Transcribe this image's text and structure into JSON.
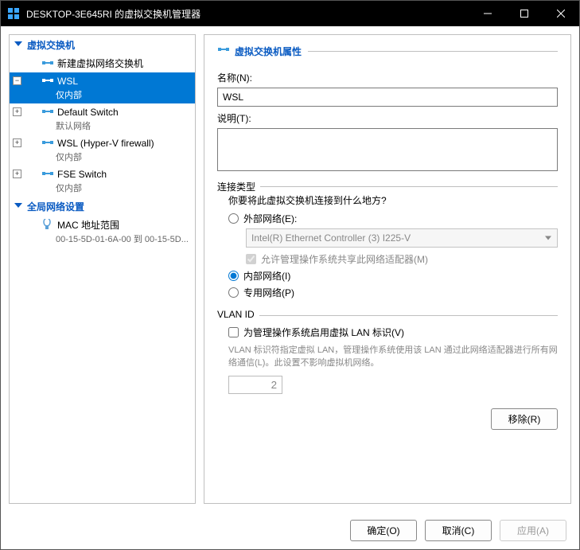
{
  "window": {
    "title": "DESKTOP-3E645RI 的虚拟交换机管理器"
  },
  "tree": {
    "section_switches": "虚拟交换机",
    "new_switch": "新建虚拟网络交换机",
    "items": [
      {
        "name": "WSL",
        "sub": "仅内部",
        "selected": true
      },
      {
        "name": "Default Switch",
        "sub": "默认网络",
        "selected": false
      },
      {
        "name": "WSL (Hyper-V firewall)",
        "sub": "仅内部",
        "selected": false
      },
      {
        "name": "FSE Switch",
        "sub": "仅内部",
        "selected": false
      }
    ],
    "section_global": "全局网络设置",
    "mac_label": "MAC 地址范围",
    "mac_value": "00-15-5D-01-6A-00 到 00-15-5D..."
  },
  "props": {
    "header": "虚拟交换机属性",
    "name_label": "名称(N):",
    "name_value": "WSL",
    "desc_label": "说明(T):",
    "desc_value": ""
  },
  "conn": {
    "legend": "连接类型",
    "question": "你要将此虚拟交换机连接到什么地方?",
    "ext_label": "外部网络(E):",
    "adapter": "Intel(R) Ethernet Controller (3) I225-V",
    "share_label": "允许管理操作系统共享此网络适配器(M)",
    "int_label": "内部网络(I)",
    "priv_label": "专用网络(P)"
  },
  "vlan": {
    "legend": "VLAN ID",
    "enable_label": "为管理操作系统启用虚拟 LAN 标识(V)",
    "note": "VLAN 标识符指定虚拟 LAN，管理操作系统使用该 LAN 通过此网络适配器进行所有网络通信(L)。此设置不影响虚拟机网络。",
    "value": "2"
  },
  "buttons": {
    "remove": "移除(R)",
    "ok": "确定(O)",
    "cancel": "取消(C)",
    "apply": "应用(A)"
  }
}
